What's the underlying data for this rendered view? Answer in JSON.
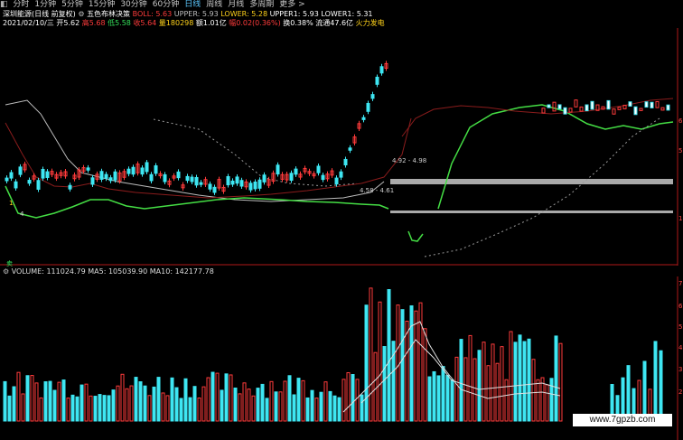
{
  "toolbar": {
    "back": "◧",
    "periods": [
      "分时",
      "1分钟",
      "5分钟",
      "15分钟",
      "30分钟",
      "60分钟",
      "日线",
      "周线",
      "月线",
      "多周期",
      "更多 >"
    ],
    "active": "日线"
  },
  "header": {
    "stock": "深圳能源(日线 前复权)",
    "indicator": "五色布林决策",
    "boll_label": "BOLL: 5.63",
    "upper_label": "UPPER: 5.93",
    "lower_label": "LOWER: 5.28",
    "upper1_label": "UPPER1: 5.93",
    "lower1_label": "LOWER1: 5.31"
  },
  "quote": {
    "date": "2021/02/10/三",
    "open_label": "开5.62",
    "high_label": "高5.68",
    "low_label": "低5.58",
    "close_label": "收5.64",
    "volume_label": "量180298",
    "amount_label": "额1.01亿",
    "change_label": "幅0.02(0.36%)",
    "turnover_label": "换0.38%",
    "float_label": "流通47.6亿",
    "sector": "火力发电"
  },
  "ranges": {
    "upper": "4.92 - 4.98",
    "lower": "4.58 - 4.61"
  },
  "markers": {
    "left_a": "1.",
    "left_b": "4",
    "marker_sell": "卖"
  },
  "price_axis": [
    "6",
    "5",
    "",
    "1"
  ],
  "volume": {
    "legend": "VOLUME: 111024.79  MA5: 105039.90  MA10: 142177.78"
  },
  "volume_axis": [
    "7",
    "6",
    "5",
    "4",
    "3",
    "2"
  ],
  "watermark": "www.7gpzb.com",
  "colors": {
    "up": "#ff3b3b",
    "down": "#3ee6f2",
    "ma_green": "#44dd44",
    "boll": "#bdbdbd",
    "dotted": "#9a9a9a"
  }
}
